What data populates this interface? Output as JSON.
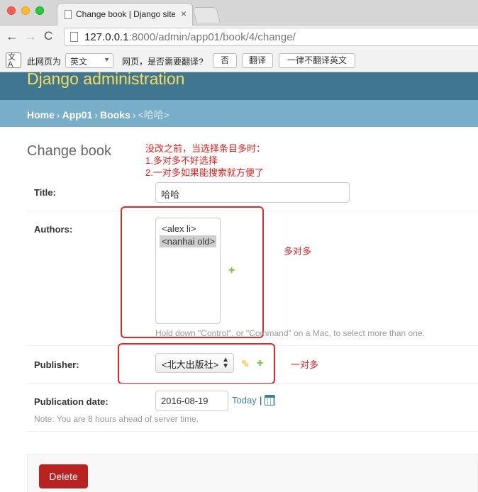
{
  "browser": {
    "tab_title": "Change book | Django site admin",
    "tab_close": "×",
    "url_host": "127.0.0.1",
    "url_rest": ":8000/admin/app01/book/4/change/",
    "back_glyph": "←",
    "forward_glyph": "→",
    "reload_glyph": "C"
  },
  "translate_bar": {
    "icon_text": "文A",
    "page_is_label": "此网页为",
    "language": "英文",
    "question": "网页，是否需要翻译?",
    "no_button": "否",
    "translate_button": "翻译",
    "never_button": "一律不翻译英文"
  },
  "header": {
    "site_title": "Django administration"
  },
  "breadcrumbs": {
    "home": "Home",
    "app": "App01",
    "model": "Books",
    "current": "<哈哈>",
    "separator": "›"
  },
  "page_title": "Change book",
  "annotations": {
    "note_line1": "没改之前，当选择条目多时：",
    "note_line2": "1.多对多不好选择",
    "note_line3": "2.一对多如果能搜索就方便了",
    "many_to_many": "多对多",
    "one_to_many": "一对多"
  },
  "form": {
    "title_label": "Title:",
    "title_value": "哈哈",
    "authors_label": "Authors:",
    "authors_options": [
      {
        "label": "<alex li>",
        "selected": false
      },
      {
        "label": "<nanhai old>",
        "selected": true
      }
    ],
    "authors_help": "Hold down \"Control\", or \"Command\" on a Mac, to select more than one.",
    "publisher_label": "Publisher:",
    "publisher_value": "<北大出版社>",
    "publication_date_label": "Publication date:",
    "publication_date_value": "2016-08-19",
    "today_link": "Today",
    "date_separator": "|",
    "date_note": "Note: You are 8 hours ahead of server time."
  },
  "actions": {
    "delete_label": "Delete"
  },
  "colors": {
    "header_bg": "#417690",
    "breadcrumb_bg": "#79aec8",
    "title_yellow": "#f5dd5d",
    "delete_red": "#ba2121",
    "annotation_red": "#e02020",
    "add_green": "#70bf2b",
    "change_yellow": "#efb80b"
  },
  "icons": [
    "document-icon",
    "calendar-icon",
    "add-icon",
    "change-pencil-icon",
    "translate-icon"
  ]
}
